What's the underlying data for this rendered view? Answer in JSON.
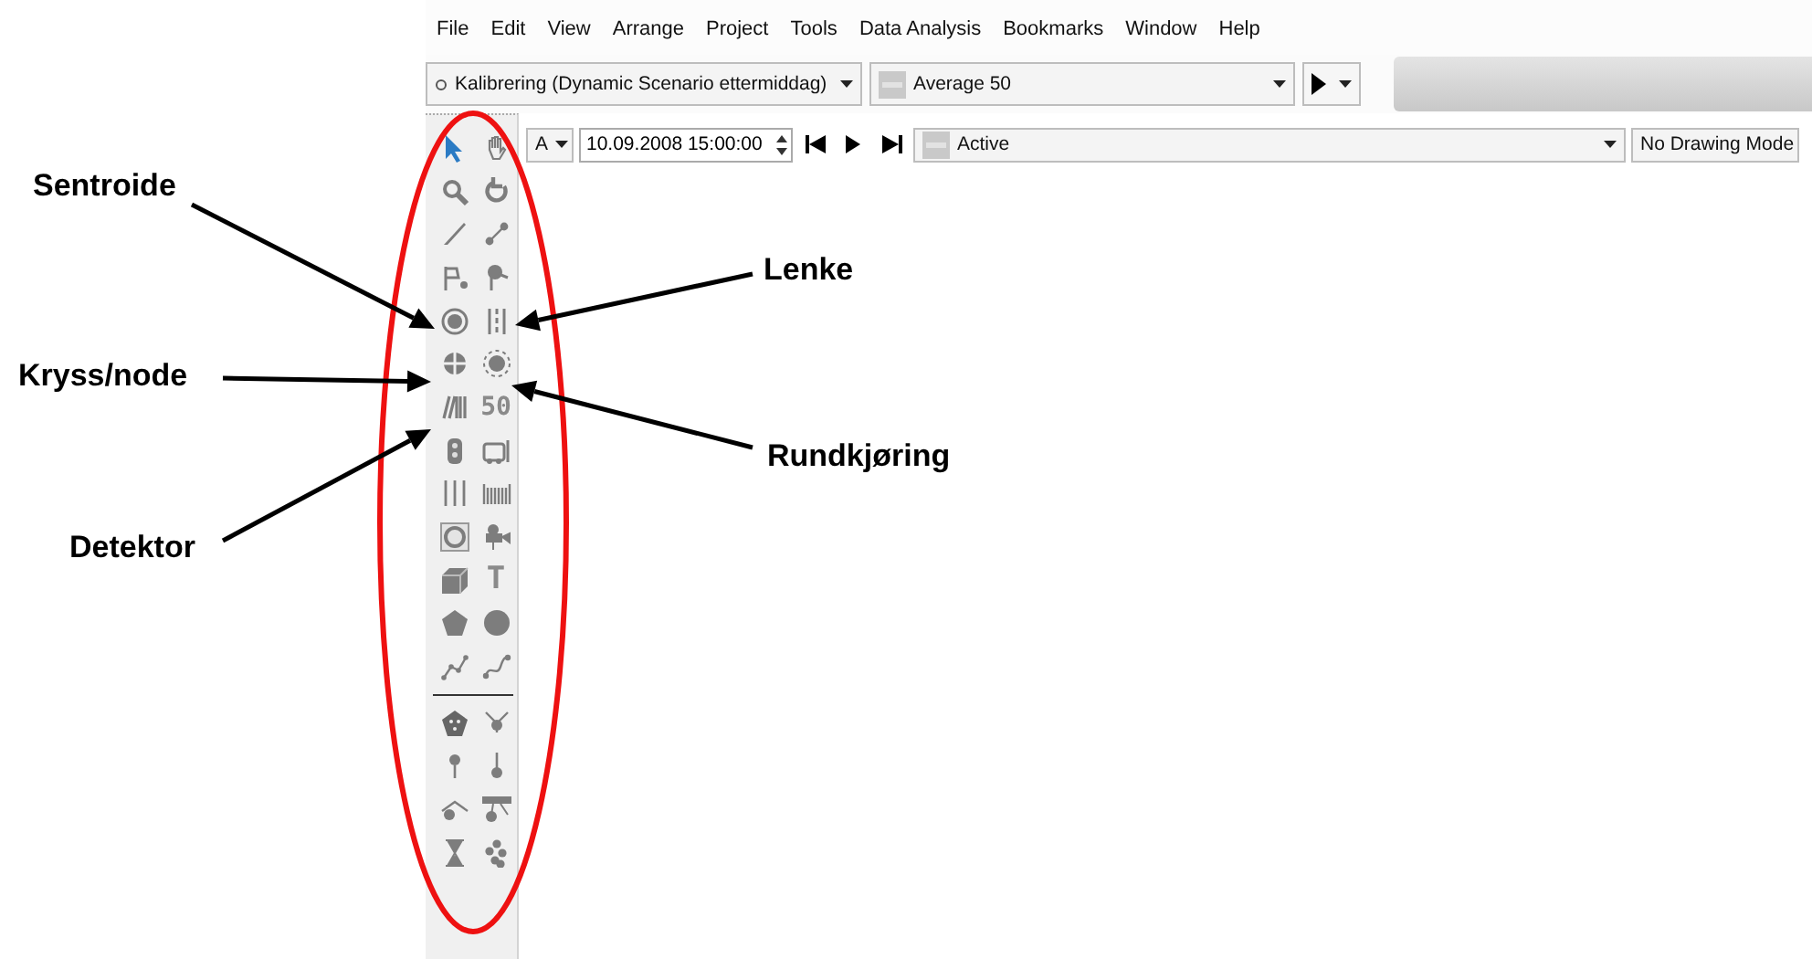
{
  "menu_bar": [
    "File",
    "Edit",
    "View",
    "Arrange",
    "Project",
    "Tools",
    "Data Analysis",
    "Bookmarks",
    "Window",
    "Help"
  ],
  "toolbar": {
    "scenario": "Kalibrering (Dynamic Scenario ettermiddag)",
    "aggregation": "Average 50"
  },
  "time_bar": {
    "mode": "A",
    "time": "10.09.2008 15:00:00",
    "filter": "Active",
    "drawing_mode": "No Drawing Mode"
  },
  "tool_groups": [
    [
      {
        "kind": "cursor"
      },
      {
        "kind": "hand"
      },
      {
        "kind": "zoom"
      },
      {
        "kind": "rotate"
      },
      {
        "kind": "pen"
      },
      {
        "kind": "node-link"
      },
      {
        "kind": "flag"
      },
      {
        "kind": "pin-flag"
      },
      {
        "kind": "target"
      },
      {
        "kind": "dashed-line"
      },
      {
        "kind": "crosshair"
      },
      {
        "kind": "ring"
      },
      {
        "kind": "bars"
      },
      {
        "kind": "label",
        "label": "50"
      },
      {
        "kind": "signal"
      },
      {
        "kind": "bus"
      },
      {
        "kind": "lines"
      },
      {
        "kind": "barcode"
      },
      {
        "kind": "boxed-c"
      },
      {
        "kind": "camera"
      },
      {
        "kind": "cube"
      },
      {
        "kind": "label",
        "label": "T"
      },
      {
        "kind": "pentagon"
      },
      {
        "kind": "circle"
      },
      {
        "kind": "polyline"
      },
      {
        "kind": "curve"
      }
    ],
    [
      {
        "kind": "dotted-pentagon"
      },
      {
        "kind": "y-node"
      },
      {
        "kind": "pin"
      },
      {
        "kind": "low-pin"
      },
      {
        "kind": "branch"
      },
      {
        "kind": "table-node"
      },
      {
        "kind": "hourglass"
      },
      {
        "kind": "cluster"
      }
    ]
  ],
  "annotations": [
    {
      "label": "Sentroide"
    },
    {
      "label": "Lenke"
    },
    {
      "label": "Kryss/node"
    },
    {
      "label": "Rundkjøring"
    },
    {
      "label": "Detektor"
    }
  ]
}
